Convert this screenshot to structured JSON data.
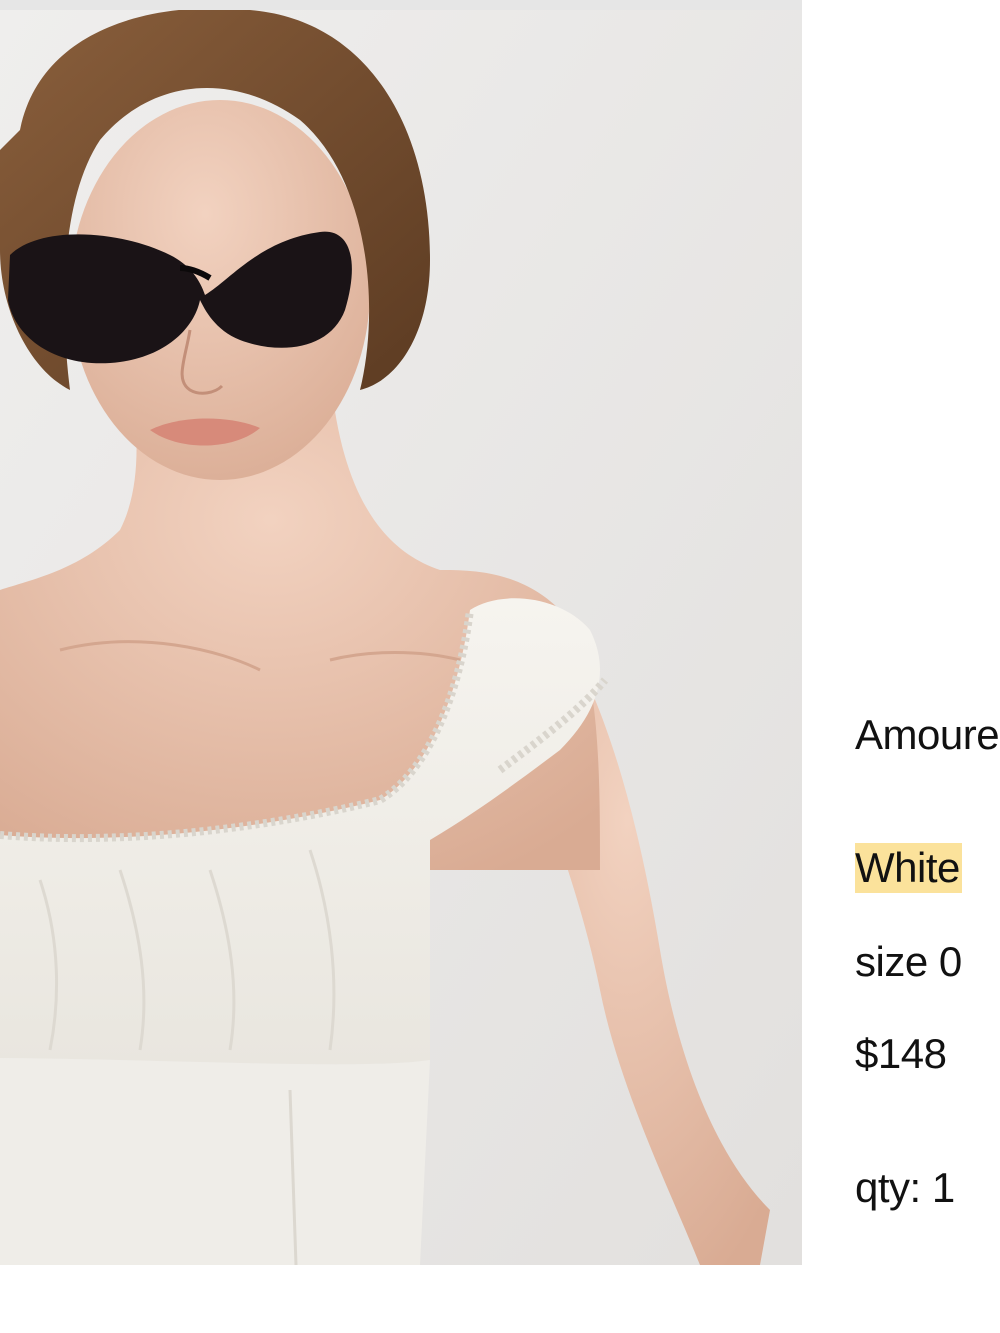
{
  "product": {
    "image_alt": "model wearing white lace-trim top and black sunglasses",
    "name": "Amoure",
    "color": "White",
    "size": "size 0",
    "price": "$148",
    "quantity": "qty: 1"
  },
  "colors": {
    "highlight": "#fbe29b",
    "text": "#111111",
    "background": "#ffffff"
  }
}
